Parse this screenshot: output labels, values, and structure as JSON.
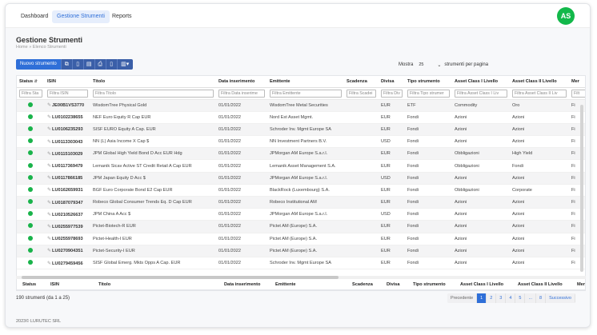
{
  "nav": {
    "items": [
      "Dashboard",
      "Gestione Strumenti",
      "Reports"
    ],
    "active": "Gestione Strumenti"
  },
  "user": {
    "initials": "AS"
  },
  "page": {
    "title": "Gestione Strumenti",
    "breadcrumb": "Home » Elenco Strumenti"
  },
  "toolbar": {
    "new_label": "Nuovo strumento",
    "icons": [
      "copy-icon",
      "csv-icon",
      "excel-icon",
      "print-icon",
      "pdf-icon",
      "columns-icon"
    ]
  },
  "pagesize": {
    "prefix": "Mostra",
    "value": "25",
    "suffix": "strumenti per pagina"
  },
  "columns": [
    "Status",
    "ISIN",
    "Titolo",
    "Data inserimento",
    "Emittente",
    "Scadenza",
    "Divisa",
    "Tipo strumento",
    "Asset Class I Livello",
    "Asset Class II Livello",
    "Mer"
  ],
  "filters": [
    "Filtra Sta",
    "Filtra ISIN",
    "Filtra Titolo",
    "Filtra Data inserime",
    "Filtra Emittente",
    "Filtra Scadei",
    "Filtra Div",
    "Filtra Tipo strumer",
    "Filtra Asset Class I Liv",
    "Filtra Asset Class II Liv",
    "Filt"
  ],
  "rows": [
    {
      "isin": "JE00B1VS3770",
      "titolo": "WisdomTree Physical Gold",
      "data": "01/01/2022",
      "emittente": "WisdomTree Metal Securities",
      "scadenza": "",
      "divisa": "EUR",
      "tipo": "ETF",
      "ac1": "Commodity",
      "ac2": "Oro",
      "mer": "Fi"
    },
    {
      "isin": "LU0102238655",
      "titolo": "NEF Euro Equity R Cap EUR",
      "data": "01/01/2022",
      "emittente": "Nord Est Asset Mgmt.",
      "scadenza": "",
      "divisa": "EUR",
      "tipo": "Fondi",
      "ac1": "Azioni",
      "ac2": "Azioni",
      "mer": "Fi"
    },
    {
      "isin": "LU0106235293",
      "titolo": "SISF EURO Equity A Cap. EUR",
      "data": "01/01/2022",
      "emittente": "Schroder Inv. Mgmt Europe SA",
      "scadenza": "",
      "divisa": "EUR",
      "tipo": "Fondi",
      "ac1": "Azioni",
      "ac2": "Azioni",
      "mer": "Fi"
    },
    {
      "isin": "LU0113303043",
      "titolo": "NN (L) Asia Income X Cap $",
      "data": "01/01/2022",
      "emittente": "NN Investment Partners B.V.",
      "scadenza": "",
      "divisa": "USD",
      "tipo": "Fondi",
      "ac1": "Azioni",
      "ac2": "Azioni",
      "mer": "Fi"
    },
    {
      "isin": "LU0115103029",
      "titolo": "JPM Global High Yield Bond D Acc EUR Hdg",
      "data": "01/01/2022",
      "emittente": "JPMorgan AM Europe S.a.r.l.",
      "scadenza": "",
      "divisa": "EUR",
      "tipo": "Fondi",
      "ac1": "Obbligazioni",
      "ac2": "High Yield",
      "mer": "Fi"
    },
    {
      "isin": "LU0117369479",
      "titolo": "Lemanik Sicav Active ST Credit Retail A Cap EUR",
      "data": "01/01/2022",
      "emittente": "Lemanik Asset Management S.A.",
      "scadenza": "",
      "divisa": "EUR",
      "tipo": "Fondi",
      "ac1": "Obbligazioni",
      "ac2": "Fondi",
      "mer": "Fi"
    },
    {
      "isin": "LU0117866185",
      "titolo": "JPM Japan Equity D Acc $",
      "data": "01/01/2022",
      "emittente": "JPMorgan AM Europe S.a.r.l.",
      "scadenza": "",
      "divisa": "USD",
      "tipo": "Fondi",
      "ac1": "Azioni",
      "ac2": "Azioni",
      "mer": "Fi"
    },
    {
      "isin": "LU0162659931",
      "titolo": "BGF Euro Corporate Bond E2 Cap EUR",
      "data": "01/01/2022",
      "emittente": "BlackRock (Luxembourg) S.A.",
      "scadenza": "",
      "divisa": "EUR",
      "tipo": "Fondi",
      "ac1": "Obbligazioni",
      "ac2": "Corporate",
      "mer": "Fi"
    },
    {
      "isin": "LU0187079347",
      "titolo": "Robeco Global Consumer Trends Eq. D Cap EUR",
      "data": "01/01/2022",
      "emittente": "Robeco Institutional AM",
      "scadenza": "",
      "divisa": "EUR",
      "tipo": "Fondi",
      "ac1": "Azioni",
      "ac2": "Azioni",
      "mer": "Fi"
    },
    {
      "isin": "LU0210526637",
      "titolo": "JPM China A Acc $",
      "data": "01/01/2022",
      "emittente": "JPMorgan AM Europe S.a.r.l.",
      "scadenza": "",
      "divisa": "USD",
      "tipo": "Fondi",
      "ac1": "Azioni",
      "ac2": "Azioni",
      "mer": "Fi"
    },
    {
      "isin": "LU0255977539",
      "titolo": "Pictet-Biotech-R EUR",
      "data": "01/01/2022",
      "emittente": "Pictet AM (Europe) S.A.",
      "scadenza": "",
      "divisa": "EUR",
      "tipo": "Fondi",
      "ac1": "Azioni",
      "ac2": "Azioni",
      "mer": "Fi"
    },
    {
      "isin": "LU0255978693",
      "titolo": "Pictet-Health-I EUR",
      "data": "01/01/2022",
      "emittente": "Pictet AM (Europe) S.A.",
      "scadenza": "",
      "divisa": "EUR",
      "tipo": "Fondi",
      "ac1": "Azioni",
      "ac2": "Azioni",
      "mer": "Fi"
    },
    {
      "isin": "LU0270904351",
      "titolo": "Pictet-Security-I EUR",
      "data": "01/01/2022",
      "emittente": "Pictet AM (Europe) S.A.",
      "scadenza": "",
      "divisa": "EUR",
      "tipo": "Fondi",
      "ac1": "Azioni",
      "ac2": "Azioni",
      "mer": "Fi"
    },
    {
      "isin": "LU0279459456",
      "titolo": "SISF Global Emerg. Mkts Opps A Cap. EUR",
      "data": "01/01/2022",
      "emittente": "Schroder Inv. Mgmt Europe SA",
      "scadenza": "",
      "divisa": "EUR",
      "tipo": "Fondi",
      "ac1": "Azioni",
      "ac2": "Azioni",
      "mer": "Fi"
    }
  ],
  "footer": {
    "count": "190 strumenti (da 1 a 25)",
    "copyright": "2023© LURUTEC SRL"
  },
  "pager": {
    "prev": "Precedente",
    "pages": [
      "1",
      "2",
      "3",
      "4",
      "5",
      "...",
      "8"
    ],
    "active": "1",
    "next": "Successivo"
  },
  "colors": {
    "accent": "#2f6fd8",
    "status_ok": "#19b34a",
    "avatar": "#12b84a"
  }
}
